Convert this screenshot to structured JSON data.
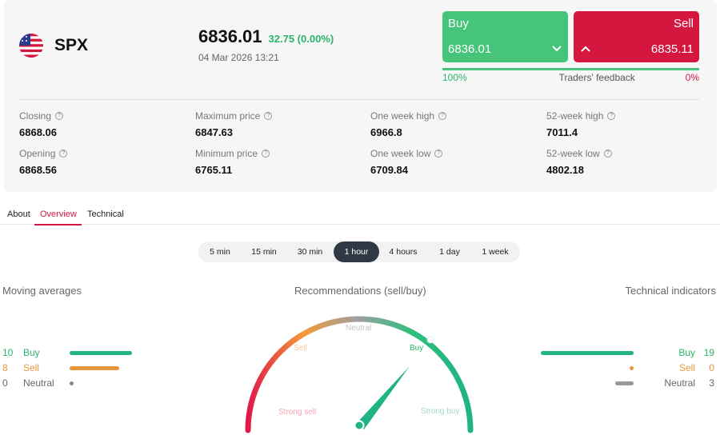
{
  "instrument": {
    "symbol": "SPX",
    "price": "6836.01",
    "change": "32.75 (0.00%)",
    "datetime": "04 Mar 2026 13:21"
  },
  "trade": {
    "buy_label": "Buy",
    "buy_price": "6836.01",
    "sell_label": "Sell",
    "sell_price": "6835.11",
    "feedback_buy": "100%",
    "feedback_label": "Traders' feedback",
    "feedback_sell": "0%",
    "feedback_buy_fraction": 1.0
  },
  "stats": [
    {
      "label": "Closing",
      "value": "6868.06"
    },
    {
      "label": "Maximum price",
      "value": "6847.63"
    },
    {
      "label": "One week high",
      "value": "6966.8"
    },
    {
      "label": "52-week high",
      "value": "7011.4"
    },
    {
      "label": "Opening",
      "value": "6868.56"
    },
    {
      "label": "Minimum price",
      "value": "6765.11"
    },
    {
      "label": "One week low",
      "value": "6709.84"
    },
    {
      "label": "52-week low",
      "value": "4802.18"
    }
  ],
  "tabs": [
    {
      "label": "About"
    },
    {
      "label": "Overview"
    },
    {
      "label": "Technical"
    }
  ],
  "active_tab": "Overview",
  "timeframes": [
    {
      "label": "5 min"
    },
    {
      "label": "15 min"
    },
    {
      "label": "30 min"
    },
    {
      "label": "1 hour"
    },
    {
      "label": "4 hours"
    },
    {
      "label": "1 day"
    },
    {
      "label": "1 week"
    }
  ],
  "active_timeframe": "1 hour",
  "moving_averages": {
    "title": "Moving averages",
    "rows": [
      {
        "count": "10",
        "label": "Buy"
      },
      {
        "count": "8",
        "label": "Sell"
      },
      {
        "count": "0",
        "label": "Neutral"
      }
    ]
  },
  "recommendations": {
    "title": "Recommendations (sell/buy)",
    "labels": {
      "strong_sell": "Strong sell",
      "sell": "Sell",
      "neutral": "Neutral",
      "buy": "Buy",
      "strong_buy": "Strong buy"
    }
  },
  "technical_indicators": {
    "title": "Technical indicators",
    "rows": [
      {
        "count": "19",
        "label": "Buy"
      },
      {
        "count": "0",
        "label": "Sell"
      },
      {
        "count": "3",
        "label": "Neutral"
      }
    ]
  },
  "colors": {
    "buy": "#45c47a",
    "sell": "#d5163f",
    "ma_sell": "#e8963a",
    "neutral": "#888888",
    "active_tab": "#d5163f"
  }
}
